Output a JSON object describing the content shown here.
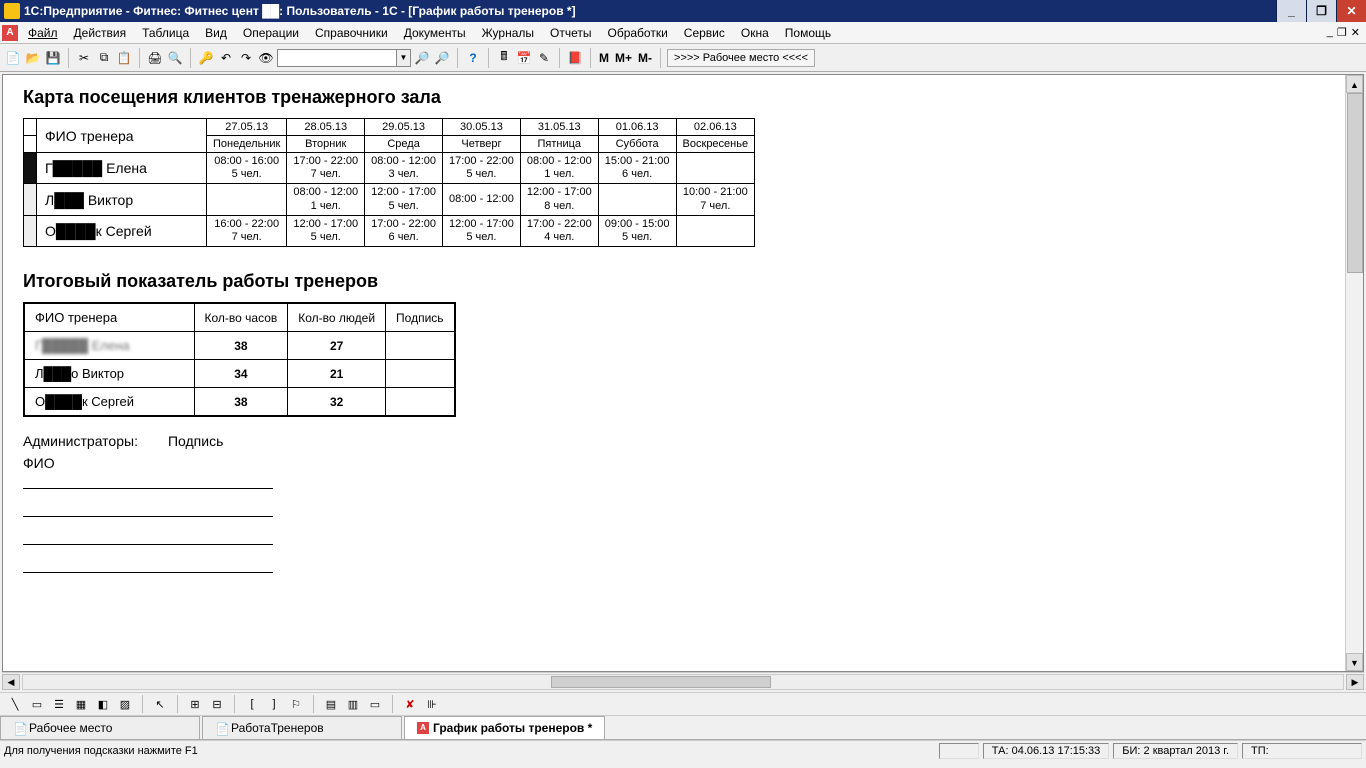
{
  "titlebar": {
    "text": "1С:Предприятие - Фитнес: Фитнес цент ██: Пользователь - 1С - [График работы тренеров  *]"
  },
  "win": {
    "min": "_",
    "max": "❐",
    "close": "✕"
  },
  "menu": {
    "file": "Файл",
    "actions": "Действия",
    "table": "Таблица",
    "view": "Вид",
    "operations": "Операции",
    "refs": "Справочники",
    "docs": "Документы",
    "journals": "Журналы",
    "reports": "Отчеты",
    "processing": "Обработки",
    "service": "Сервис",
    "windows": "Окна",
    "help": "Помощь"
  },
  "mdi": {
    "min": "_",
    "max": "❐",
    "close": "✕"
  },
  "toolbar": {
    "search_value": "",
    "m": "M",
    "mplus": "M+",
    "mminus": "M-",
    "workplace": ">>>>  Рабочее место  <<<<"
  },
  "doc": {
    "title1": "Карта посещения клиентов тренажерного зала",
    "fio_header": "ФИО тренера",
    "dates": [
      "27.05.13",
      "28.05.13",
      "29.05.13",
      "30.05.13",
      "31.05.13",
      "01.06.13",
      "02.06.13"
    ],
    "days": [
      "Понедельник",
      "Вторник",
      "Среда",
      "Четверг",
      "Пятница",
      "Суббота",
      "Воскресенье"
    ],
    "trainers": [
      {
        "name": "Г█████ Елена",
        "cells": [
          {
            "t": "08:00 - 16:00",
            "p": "5 чел."
          },
          {
            "t": "17:00 - 22:00",
            "p": "7 чел."
          },
          {
            "t": "08:00 - 12:00",
            "p": "3 чел."
          },
          {
            "t": "17:00 - 22:00",
            "p": "5 чел."
          },
          {
            "t": "08:00 - 12:00",
            "p": "1 чел."
          },
          {
            "t": "15:00 - 21:00",
            "p": "6 чел."
          },
          {
            "t": "",
            "p": ""
          }
        ]
      },
      {
        "name": "Л███ Виктор",
        "cells": [
          {
            "t": "",
            "p": ""
          },
          {
            "t": "08:00 - 12:00",
            "p": "1 чел."
          },
          {
            "t": "12:00 - 17:00",
            "p": "5 чел."
          },
          {
            "t": "08:00 - 12:00",
            "p": ""
          },
          {
            "t": "12:00 - 17:00",
            "p": "8 чел."
          },
          {
            "t": "",
            "p": ""
          },
          {
            "t": "10:00 - 21:00",
            "p": "7 чел."
          }
        ]
      },
      {
        "name": "О████к Сергей",
        "cells": [
          {
            "t": "16:00 - 22:00",
            "p": "7 чел."
          },
          {
            "t": "12:00 - 17:00",
            "p": "5 чел."
          },
          {
            "t": "17:00 - 22:00",
            "p": "6 чел."
          },
          {
            "t": "12:00 - 17:00",
            "p": "5 чел."
          },
          {
            "t": "17:00 - 22:00",
            "p": "4 чел."
          },
          {
            "t": "09:00 - 15:00",
            "p": "5 чел."
          },
          {
            "t": "",
            "p": ""
          }
        ]
      }
    ],
    "title2": "Итоговый показатель работы тренеров",
    "sum_headers": {
      "fio": "ФИО тренера",
      "hours": "Кол-во часов",
      "people": "Кол-во людей",
      "sign": "Подпись"
    },
    "summary": [
      {
        "name": "Г█████ Елена",
        "hours": "38",
        "people": "27"
      },
      {
        "name": "Л███о Виктор",
        "hours": "34",
        "people": "21"
      },
      {
        "name": "О████к Сергей",
        "hours": "38",
        "people": "32"
      }
    ],
    "admins_label": "Администраторы:",
    "sign_label": "Подпись",
    "fio_label": "ФИО"
  },
  "tabs": {
    "t1": "Рабочее место",
    "t2": "РаботаТренеров",
    "t3": "График работы тренеров  *"
  },
  "statusbar": {
    "hint": "Для получения подсказки нажмите F1",
    "ta": "ТА: 04.06.13  17:15:33",
    "bi": "БИ: 2 квартал 2013 г.",
    "tp": "ТП:"
  }
}
